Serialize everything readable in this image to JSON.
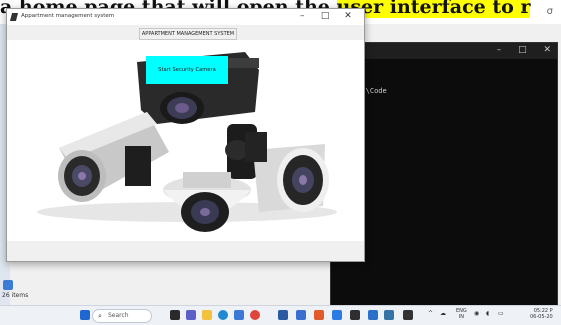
{
  "background_doc": {
    "text_plain": "a home page that will open the ",
    "text_highlight": "user interface to r",
    "win_controls": [
      "–",
      "σ"
    ]
  },
  "terminal": {
    "controls": [
      "–",
      "□",
      "✕"
    ],
    "line": "ion\\Code"
  },
  "explorer": {
    "items_label": "26 items"
  },
  "app": {
    "title": "Appartment management system",
    "controls": {
      "minimize": "–",
      "maximize": "□",
      "close": "✕"
    },
    "system_label": "APPARTMENT MANAGEMENT SYSTEM",
    "start_button": "Start Security Camera"
  },
  "taskbar": {
    "search_placeholder": "Search",
    "lang": "ENG",
    "region": "IN",
    "time": "05:22 P",
    "date": "06-05-20",
    "colors": {
      "start": "#1e66d0",
      "accent": "#00ffff"
    }
  }
}
